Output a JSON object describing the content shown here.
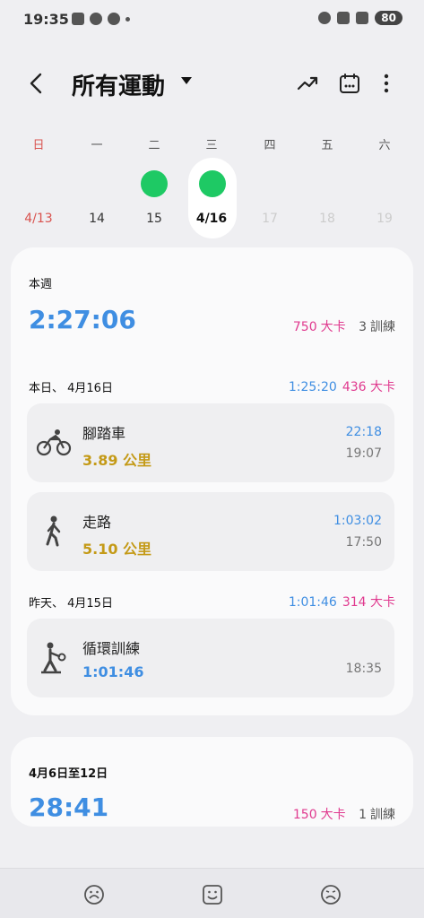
{
  "status_bar": {
    "time": "19:35",
    "battery": "80"
  },
  "header": {
    "title": "所有運動"
  },
  "week": {
    "days": [
      {
        "dow": "日",
        "date": "4/13",
        "has_activity": false,
        "state": "sun"
      },
      {
        "dow": "一",
        "date": "14",
        "has_activity": false,
        "state": "past"
      },
      {
        "dow": "二",
        "date": "15",
        "has_activity": true,
        "state": "past"
      },
      {
        "dow": "三",
        "date": "4/16",
        "has_activity": true,
        "state": "today"
      },
      {
        "dow": "四",
        "date": "17",
        "has_activity": false,
        "state": "future"
      },
      {
        "dow": "五",
        "date": "18",
        "has_activity": false,
        "state": "future"
      },
      {
        "dow": "六",
        "date": "19",
        "has_activity": false,
        "state": "future"
      }
    ]
  },
  "this_week": {
    "label": "本週",
    "total_time": "2:27:06",
    "kcal": "750",
    "kcal_unit": "大卡",
    "sessions": "3",
    "sessions_unit": "訓練"
  },
  "days": [
    {
      "label": "本日、 4月16日",
      "duration": "1:25:20",
      "kcal": "436 大卡",
      "activities": [
        {
          "name": "腳踏車",
          "value": "3.89 公里",
          "duration": "22:18",
          "clock": "19:07",
          "icon": "cycling-icon"
        },
        {
          "name": "走路",
          "value": "5.10 公里",
          "duration": "1:03:02",
          "clock": "17:50",
          "icon": "walking-icon"
        }
      ]
    },
    {
      "label": "昨天、 4月15日",
      "duration": "1:01:46",
      "kcal": "314 大卡",
      "activities": [
        {
          "name": "循環訓練",
          "value": "1:01:46",
          "duration": "",
          "clock": "18:35",
          "icon": "circuit-training-icon"
        }
      ]
    }
  ],
  "prev_week": {
    "label": "4月6日至12日",
    "total_time": "28:41",
    "kcal": "150",
    "kcal_unit": "大卡",
    "sessions": "1",
    "sessions_unit": "訓練"
  },
  "colors": {
    "accent_blue": "#3f8ee2",
    "kcal_pink": "#e03a8f",
    "distance_gold": "#c49a17",
    "activity_green": "#1ec964",
    "sunday_red": "#d9534f"
  }
}
